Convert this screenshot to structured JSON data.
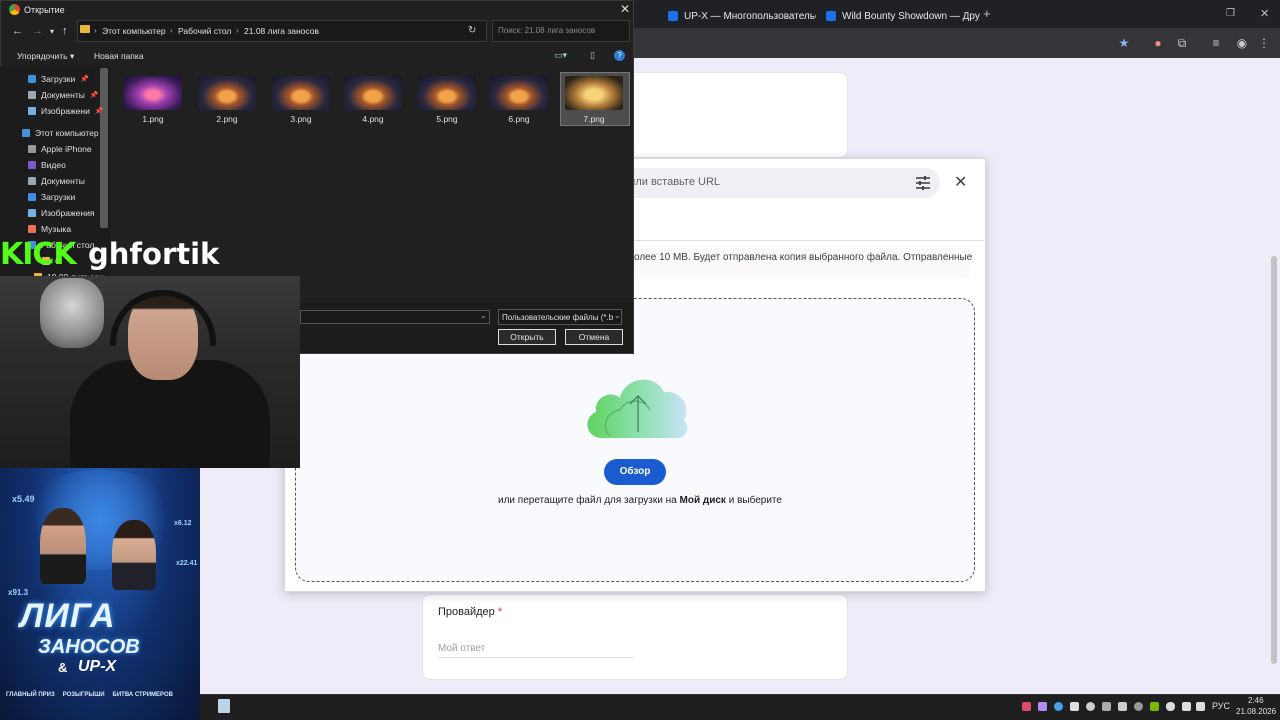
{
  "browser": {
    "tabs": [
      {
        "title": "UP-X — Многопользовательс"
      },
      {
        "title": "Wild Bounty Showdown — Дру"
      }
    ],
    "new_tab": "+"
  },
  "upload_dialog": {
    "url_placeholder": "е или вставьте URL",
    "info_text": "олее 10 MB. Будет отправлена копия выбранного файла. Отправленные",
    "browse_label": "Обзор",
    "drop_hint_prefix": "или перетащите файл для загрузки на",
    "drop_hint_bold": "Мой диск",
    "drop_hint_suffix": "и выберите"
  },
  "form": {
    "provider_label": "Провайдер",
    "required_mark": "*",
    "answer_placeholder": "Мой ответ"
  },
  "file_dialog": {
    "title": "Открытие",
    "breadcrumbs": [
      "Этот компьютер",
      "Рабочий стол",
      "21.08 лига заносов"
    ],
    "search_placeholder": "Поиск: 21.08 лига заносов",
    "organize_label": "Упорядочить ▾",
    "new_folder_label": "Новая папка",
    "nav_items": [
      {
        "label": "Загрузки",
        "color": "#3d8fe0",
        "pinned": true
      },
      {
        "label": "Документы",
        "color": "#9aa6b2",
        "pinned": true
      },
      {
        "label": "Изображени",
        "color": "#6fb3e8",
        "pinned": true
      },
      {
        "label": "Этот компьютер",
        "color": "#4a90d9",
        "pinned": false
      },
      {
        "label": "Apple iPhone",
        "color": "#9a9a9a",
        "pinned": false
      },
      {
        "label": "Видео",
        "color": "#7b5cc9",
        "pinned": false
      },
      {
        "label": "Документы",
        "color": "#9aa6b2",
        "pinned": false
      },
      {
        "label": "Загрузки",
        "color": "#3d8fe0",
        "pinned": false
      },
      {
        "label": "Изображения",
        "color": "#6fb3e8",
        "pinned": false
      },
      {
        "label": "Музыка",
        "color": "#e86f5b",
        "pinned": false
      },
      {
        "label": "Рабочий стол",
        "color": "#3d8fe0",
        "pinned": false
      },
      {
        "label": "С",
        "color": "#e8b93b",
        "pinned": false
      },
      {
        "label": "19.08 лига зан",
        "color": "#e8b93b",
        "pinned": false
      }
    ],
    "files": [
      "1.png",
      "2.png",
      "3.png",
      "4.png",
      "5.png",
      "6.png",
      "7.png"
    ],
    "selected_file": "7.png",
    "file_type": "Пользовательские файлы (*.b",
    "open_label": "Открыть",
    "cancel_label": "Отмена"
  },
  "stream": {
    "platform_logo": "KICK",
    "channel_name": "ghfortik"
  },
  "promo": {
    "multipliers": [
      "x5.49",
      "x6.12",
      "x22.41",
      "x91.3"
    ],
    "title_line1": "ЛИГА",
    "title_line2": "ЗАНОСОВ",
    "amp": "&",
    "brand": "UP-X",
    "footer": [
      "ГЛАВНЫЙ ПРИЗ",
      "РОЗЫГРЫШИ",
      "БИТВА СТРИМЕРОВ"
    ]
  },
  "taskbar": {
    "language": "РУС",
    "time": "2:46",
    "date": "21.08.2026"
  }
}
